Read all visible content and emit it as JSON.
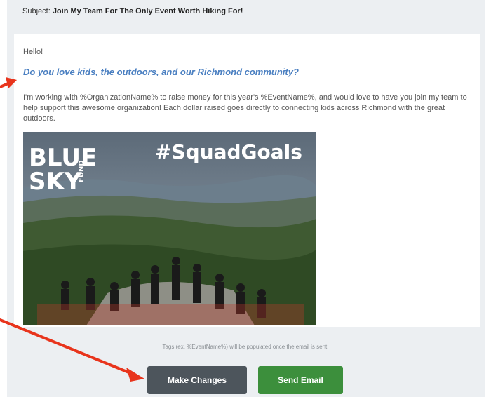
{
  "subject": {
    "label": "Subject:",
    "text": "Join My Team For The Only Event Worth Hiking For!"
  },
  "email": {
    "greeting": "Hello!",
    "headline": "Do you love kids, the outdoors, and our Richmond community?",
    "paragraph": "I'm working with %OrganizationName% to raise money for this year's %EventName%, and would love to have you join my team to help support this awesome organization! Each dollar raised goes directly to connecting kids across Richmond with the great outdoors.",
    "image": {
      "logo_line1": "BLUE",
      "logo_line2": "SKY",
      "logo_line3": "FUND",
      "hashtag": "#SquadGoals"
    }
  },
  "footer": {
    "tags_note": "Tags (ex. %EventName%) will be populated once the email is sent.",
    "make_changes_label": "Make Changes",
    "send_email_label": "Send Email"
  },
  "colors": {
    "panel_bg": "#eceff2",
    "headline": "#4a7fc1",
    "make_changes_btn": "#4d555c",
    "send_email_btn": "#3c8f3c",
    "arrow": "#e8341c"
  }
}
